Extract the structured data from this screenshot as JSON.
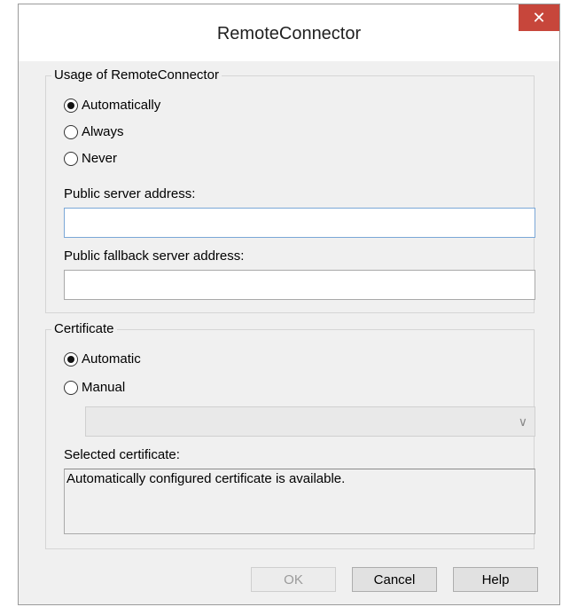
{
  "window": {
    "title": "RemoteConnector",
    "close_glyph": "✕"
  },
  "usage_group": {
    "legend": "Usage of RemoteConnector",
    "options": [
      {
        "label": "Automatically",
        "selected": true
      },
      {
        "label": "Always",
        "selected": false
      },
      {
        "label": "Never",
        "selected": false
      }
    ],
    "public_server_label": "Public server address:",
    "public_server_value": "",
    "public_fallback_label": "Public fallback server address:",
    "public_fallback_value": ""
  },
  "certificate_group": {
    "legend": "Certificate",
    "options": [
      {
        "label": "Automatic",
        "selected": true
      },
      {
        "label": "Manual",
        "selected": false
      }
    ],
    "dropdown_value": "",
    "selected_label": "Selected certificate:",
    "selected_text": "Automatically configured certificate is available."
  },
  "buttons": {
    "ok": "OK",
    "cancel": "Cancel",
    "help": "Help"
  }
}
